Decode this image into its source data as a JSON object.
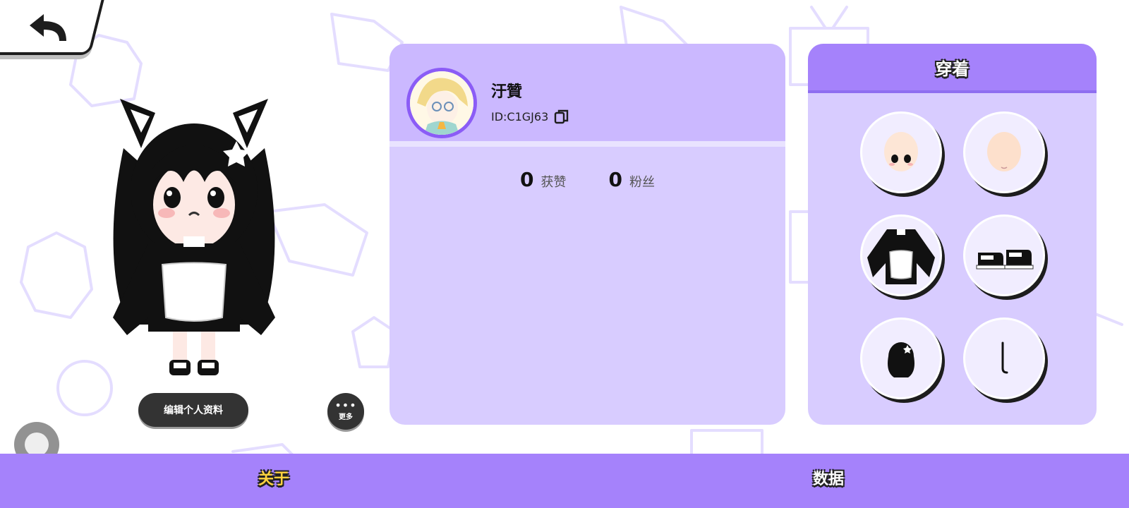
{
  "header": {
    "back_icon": "back-arrow-icon"
  },
  "profile": {
    "name": "汙贊",
    "id_text": "ID:C1GJ63",
    "avatar_icon": "anime-avatar-image",
    "stats": [
      {
        "value": "0",
        "label": "获赞"
      },
      {
        "value": "0",
        "label": "粉丝"
      }
    ]
  },
  "character": {
    "edit_button_label": "编辑个人资料",
    "more_button_label": "更多"
  },
  "outfit": {
    "title": "穿着",
    "slots": [
      "face-icon",
      "head-icon",
      "dress-icon",
      "shoes-icon",
      "hair-icon",
      "accessory-icon"
    ]
  },
  "tabs": [
    {
      "label": "关于",
      "active": true
    },
    {
      "label": "数据",
      "active": false
    }
  ],
  "colors": {
    "accent": "#a582fb",
    "panel": "#d8ccff",
    "panel_header": "#cbb8ff",
    "active_tab": "#ffd23f"
  }
}
